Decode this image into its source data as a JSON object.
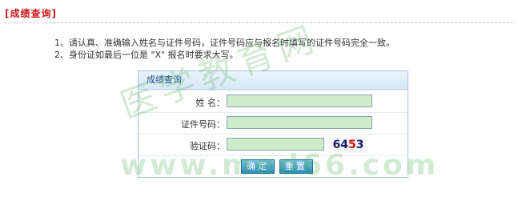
{
  "page": {
    "title": "[成绩查询]"
  },
  "notes": [
    "1、请认真、准确输入姓名与证件号码，证件号码应与报名时填写的证件号码完全一致。",
    "2、身份证如最后一位是  \"X\" 报名时要求大写。"
  ],
  "watermark": {
    "chinese": "医学教育网",
    "url": "www.med66.com"
  },
  "form": {
    "header": "成绩查询",
    "name_label": "姓  名：",
    "name_value": "",
    "id_label": "证件号码：",
    "id_value": "",
    "captcha_label": "验证码：",
    "captcha_value": "",
    "captcha_code": "6453",
    "captcha_digits": [
      "6",
      "4",
      "5",
      "3"
    ],
    "submit_label": "确定",
    "reset_label": "重置"
  },
  "colors": {
    "title": "#d0191a",
    "field_bg": "#cdebc8",
    "header_text": "#1d4f88",
    "button": "#2e8ec0"
  }
}
